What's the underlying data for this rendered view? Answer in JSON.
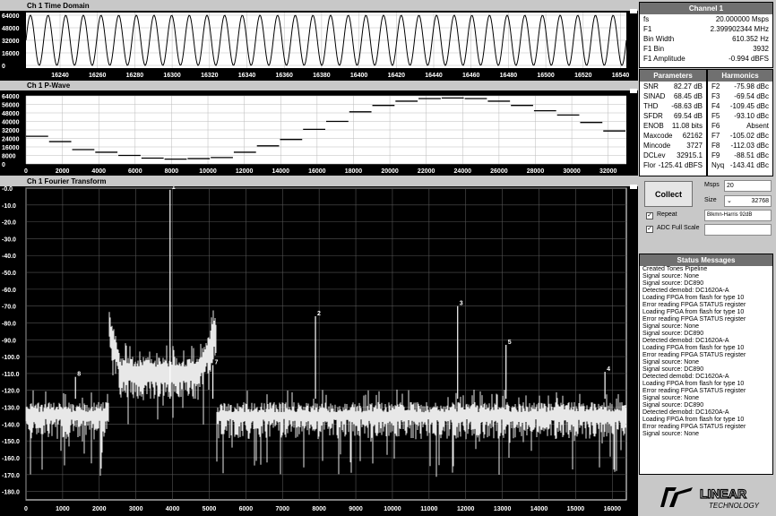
{
  "time_domain": {
    "title": "Ch 1 Time Domain",
    "yticks": [
      "64000",
      "48000",
      "32000",
      "16000",
      "0"
    ],
    "xticks": [
      "16240",
      "16260",
      "16280",
      "16300",
      "16320",
      "16340",
      "16360",
      "16380",
      "16400",
      "16420",
      "16440",
      "16460",
      "16480",
      "16500",
      "16520",
      "16540"
    ],
    "cycles": 34
  },
  "pwave": {
    "title": "Ch 1 P-Wave",
    "yticks": [
      "64000",
      "56000",
      "48000",
      "40000",
      "32000",
      "24000",
      "16000",
      "8000",
      "0"
    ],
    "xticks": [
      "0",
      "2000",
      "4000",
      "6000",
      "8000",
      "10000",
      "12000",
      "14000",
      "16000",
      "18000",
      "20000",
      "22000",
      "24000",
      "26000",
      "28000",
      "30000",
      "32000"
    ],
    "levels": [
      26000,
      21000,
      13500,
      11000,
      8000,
      5500,
      4500,
      5000,
      6000,
      11000,
      17000,
      23000,
      32500,
      40000,
      49000,
      55000,
      59000,
      61500,
      62000,
      61500,
      59000,
      55000,
      50000,
      46000,
      39000,
      31000
    ]
  },
  "fft": {
    "title": "Ch 1 Fourier Transform",
    "yticks": [
      "-0.0",
      "-10.0",
      "-20.0",
      "-30.0",
      "-40.0",
      "-50.0",
      "-60.0",
      "-70.0",
      "-80.0",
      "-90.0",
      "-100.0",
      "-110.0",
      "-120.0",
      "-130.0",
      "-140.0",
      "-150.0",
      "-160.0",
      "-170.0",
      "-180.0"
    ],
    "xticks": [
      "0",
      "1000",
      "2000",
      "3000",
      "4000",
      "5000",
      "6000",
      "7000",
      "8000",
      "9000",
      "10000",
      "11000",
      "12000",
      "13000",
      "14000",
      "15000",
      "16000"
    ],
    "harmonics": [
      {
        "label": "1",
        "x": 3932,
        "y": -1.0
      },
      {
        "label": "2",
        "x": 7900,
        "y": -76
      },
      {
        "label": "3",
        "x": 11780,
        "y": -70
      },
      {
        "label": "5",
        "x": 13100,
        "y": -93
      },
      {
        "label": "4",
        "x": 15800,
        "y": -109
      },
      {
        "label": "7",
        "x": 5100,
        "y": -105
      },
      {
        "label": "8",
        "x": 1350,
        "y": -112
      }
    ]
  },
  "channel": {
    "title": "Channel 1",
    "rows": [
      {
        "k": "fs",
        "v": "20.000000 Msps"
      },
      {
        "k": "F1",
        "v": "2.399902344 MHz"
      },
      {
        "k": "Bin Width",
        "v": "610.352 Hz"
      },
      {
        "k": "F1 Bin",
        "v": "3932"
      },
      {
        "k": "F1 Amplitude",
        "v": "-0.994 dBFS"
      }
    ]
  },
  "parameters": {
    "title": "Parameters",
    "rows": [
      {
        "k": "SNR",
        "v": "82.27 dB"
      },
      {
        "k": "SINAD",
        "v": "68.45 dB"
      },
      {
        "k": "THD",
        "v": "-68.63 dB"
      },
      {
        "k": "SFDR",
        "v": "69.54 dB"
      },
      {
        "k": "ENOB",
        "v": "11.08 bits"
      },
      {
        "k": "Maxcode",
        "v": "62162"
      },
      {
        "k": "Mincode",
        "v": "3727"
      },
      {
        "k": "DCLev",
        "v": "32915.1"
      },
      {
        "k": "Flor",
        "v": "-125.41 dBFS"
      }
    ]
  },
  "harmonics": {
    "title": "Harmonics",
    "rows": [
      {
        "k": "F2",
        "v": "-75.98 dBc"
      },
      {
        "k": "F3",
        "v": "-69.54 dBc"
      },
      {
        "k": "F4",
        "v": "-109.45 dBc"
      },
      {
        "k": "F5",
        "v": "-93.10 dBc"
      },
      {
        "k": "F6",
        "v": "Absent"
      },
      {
        "k": "F7",
        "v": "-105.02 dBc"
      },
      {
        "k": "F8",
        "v": "-112.03 dBc"
      },
      {
        "k": "F9",
        "v": "-88.51 dBc"
      },
      {
        "k": "Nyq",
        "v": "-143.41 dBc"
      }
    ]
  },
  "controls": {
    "collect_label": "Collect",
    "msps_label": "Msps",
    "msps_value": "20",
    "size_label": "Size",
    "size_value": "32768",
    "repeat_label": "Repeat",
    "window_value": "Blkmn-Harris 92dB",
    "adc_full_scale_label": "ADC Full Scale",
    "adc_full_scale_checked": true,
    "repeat_checked": true
  },
  "status": {
    "title": "Status Messages",
    "lines": [
      "Created Tones Pipeline",
      "Signal source: None",
      "Signal source: DC890",
      "Detected demobd: DC1620A-A",
      "Loading FPGA from flash for type 10",
      "Error reading FPGA STATUS register",
      "Loading FPGA from flash for type 10",
      "Error reading FPGA STATUS register",
      "Signal source: None",
      "Signal source: DC890",
      "Detected demobd: DC1620A-A",
      "Loading FPGA from flash for type 10",
      "Error reading FPGA STATUS register",
      "Signal source: None",
      "Signal source: DC890",
      "Detected demobd: DC1620A-A",
      "Loading FPGA from flash for type 10",
      "Error reading FPGA STATUS register",
      "Signal source: None",
      "Signal source: DC890",
      "Detected demobd: DC1620A-A",
      "Loading FPGA from flash for type 10",
      "Error reading FPGA STATUS register",
      "Signal source: None"
    ]
  },
  "logo": {
    "brand": "LINEAR",
    "sub": "TECHNOLOGY"
  }
}
